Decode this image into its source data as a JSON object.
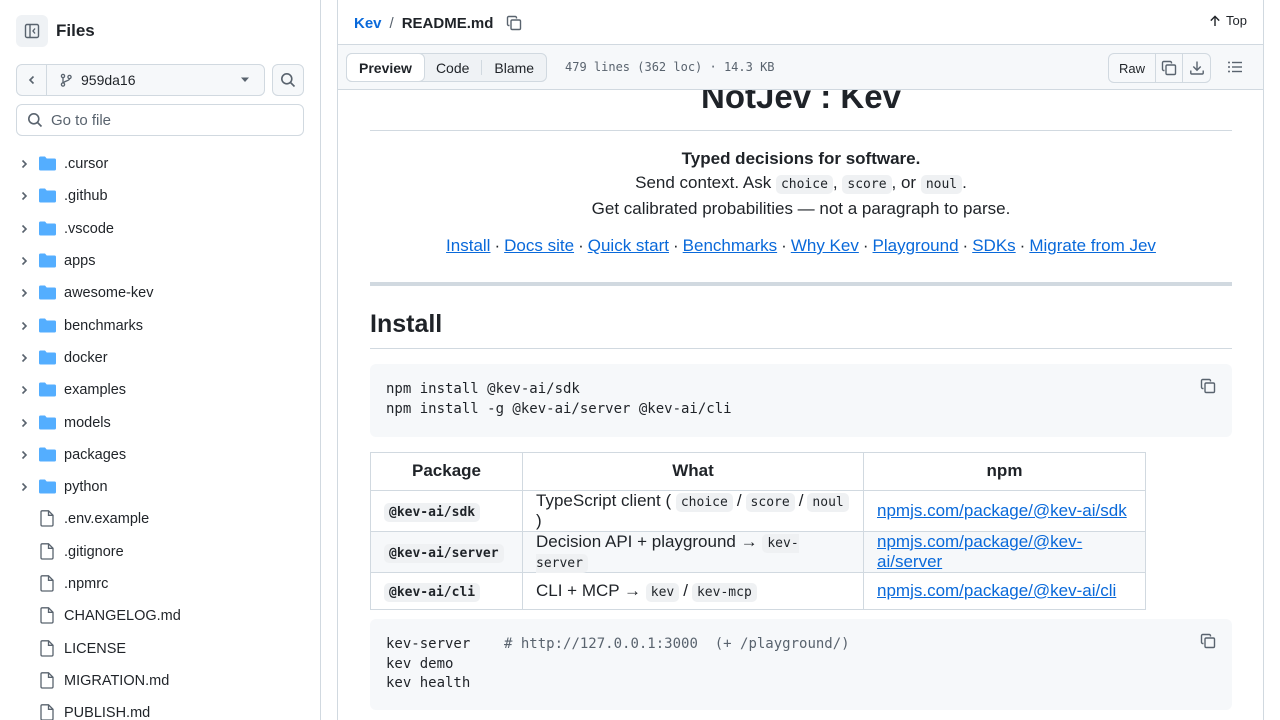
{
  "sidebar": {
    "title": "Files",
    "branch": "959da16",
    "goto_placeholder": "Go to file",
    "items": [
      {
        "label": ".cursor",
        "type": "folder"
      },
      {
        "label": ".github",
        "type": "folder"
      },
      {
        "label": ".vscode",
        "type": "folder"
      },
      {
        "label": "apps",
        "type": "folder"
      },
      {
        "label": "awesome-kev",
        "type": "folder"
      },
      {
        "label": "benchmarks",
        "type": "folder"
      },
      {
        "label": "docker",
        "type": "folder"
      },
      {
        "label": "examples",
        "type": "folder"
      },
      {
        "label": "models",
        "type": "folder"
      },
      {
        "label": "packages",
        "type": "folder"
      },
      {
        "label": "python",
        "type": "folder"
      },
      {
        "label": ".env.example",
        "type": "file"
      },
      {
        "label": ".gitignore",
        "type": "file"
      },
      {
        "label": ".npmrc",
        "type": "file"
      },
      {
        "label": "CHANGELOG.md",
        "type": "file"
      },
      {
        "label": "LICENSE",
        "type": "file"
      },
      {
        "label": "MIGRATION.md",
        "type": "file"
      },
      {
        "label": "PUBLISH.md",
        "type": "file"
      }
    ]
  },
  "header": {
    "repo": "Kev",
    "separator": "/",
    "file": "README.md",
    "top_label": "Top"
  },
  "toolbar": {
    "tabs": [
      "Preview",
      "Code",
      "Blame"
    ],
    "active_tab": "Preview",
    "meta": "479 lines (362 loc) · 14.3 KB",
    "raw_label": "Raw"
  },
  "readme": {
    "title": "NotJev : Kev",
    "tagline": "Typed decisions for software.",
    "line2_prefix": "Send context. Ask",
    "line2_codes": [
      "choice",
      "score",
      "noul"
    ],
    "line2_comma": ",",
    "line2_or": ", or",
    "line2_end": ".",
    "line3": "Get calibrated probabilities — not a paragraph to parse.",
    "nav_separator": "·",
    "nav_links": [
      "Install",
      "Docs site",
      "Quick start",
      "Benchmarks",
      "Why Kev",
      "Playground",
      "SDKs",
      "Migrate from Jev"
    ],
    "install_heading": "Install",
    "install_code": [
      "npm install @kev-ai/sdk",
      "npm install -g @kev-ai/server @kev-ai/cli"
    ],
    "table": {
      "headers": [
        "Package",
        "What",
        "npm"
      ],
      "rows": [
        {
          "package": "@kev-ai/sdk",
          "what_text": "TypeScript client (",
          "what_codes": [
            "choice",
            "score",
            "noul"
          ],
          "what_slash": "/",
          "what_close": ")",
          "npm": "npmjs.com/package/@kev-ai/sdk"
        },
        {
          "package": "@kev-ai/server",
          "what_text": "Decision API + playground →",
          "what_codes": [
            "kev-server"
          ],
          "npm": "npmjs.com/package/@kev-ai/server"
        },
        {
          "package": "@kev-ai/cli",
          "what_text": "CLI + MCP →",
          "what_codes": [
            "kev",
            "kev-mcp"
          ],
          "what_slash": "/",
          "npm": "npmjs.com/package/@kev-ai/cli"
        }
      ]
    },
    "run_code": {
      "line1_cmd": "kev-server",
      "line1_comment": "# http://127.0.0.1:3000  (+ /playground/)",
      "line2": "kev demo",
      "line3": "kev health"
    }
  }
}
